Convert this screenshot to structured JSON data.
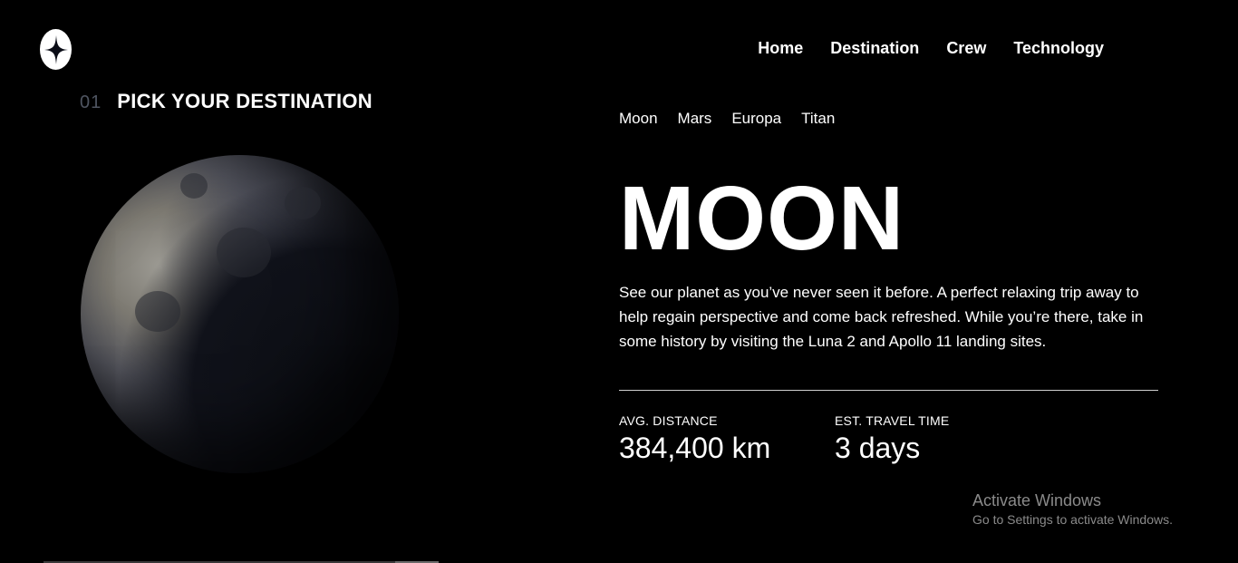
{
  "header": {
    "logo_icon": "star-logo-icon",
    "nav": [
      {
        "label": "Home"
      },
      {
        "label": "Destination"
      },
      {
        "label": "Crew"
      },
      {
        "label": "Technology"
      }
    ]
  },
  "section": {
    "number": "01",
    "title": "PICK YOUR DESTINATION"
  },
  "tabs": [
    "Moon",
    "Mars",
    "Europa",
    "Titan"
  ],
  "destination": {
    "name": "MOON",
    "description": "See our planet as you’ve never seen it before. A perfect relaxing trip away to help regain perspective and come back refreshed. While you’re there, take in some history by visiting the Luna 2 and Apollo 11 landing sites.",
    "stats": {
      "distance_label": "AVG. DISTANCE",
      "distance_value": "384,400 km",
      "time_label": "EST. TRAVEL TIME",
      "time_value": "3 days"
    }
  },
  "watermark": {
    "title": "Activate Windows",
    "subtitle": "Go to Settings to activate Windows."
  },
  "colors": {
    "background": "#000000",
    "text": "#ffffff",
    "section_number": "#4f5561",
    "watermark": "#8a8a8a"
  }
}
